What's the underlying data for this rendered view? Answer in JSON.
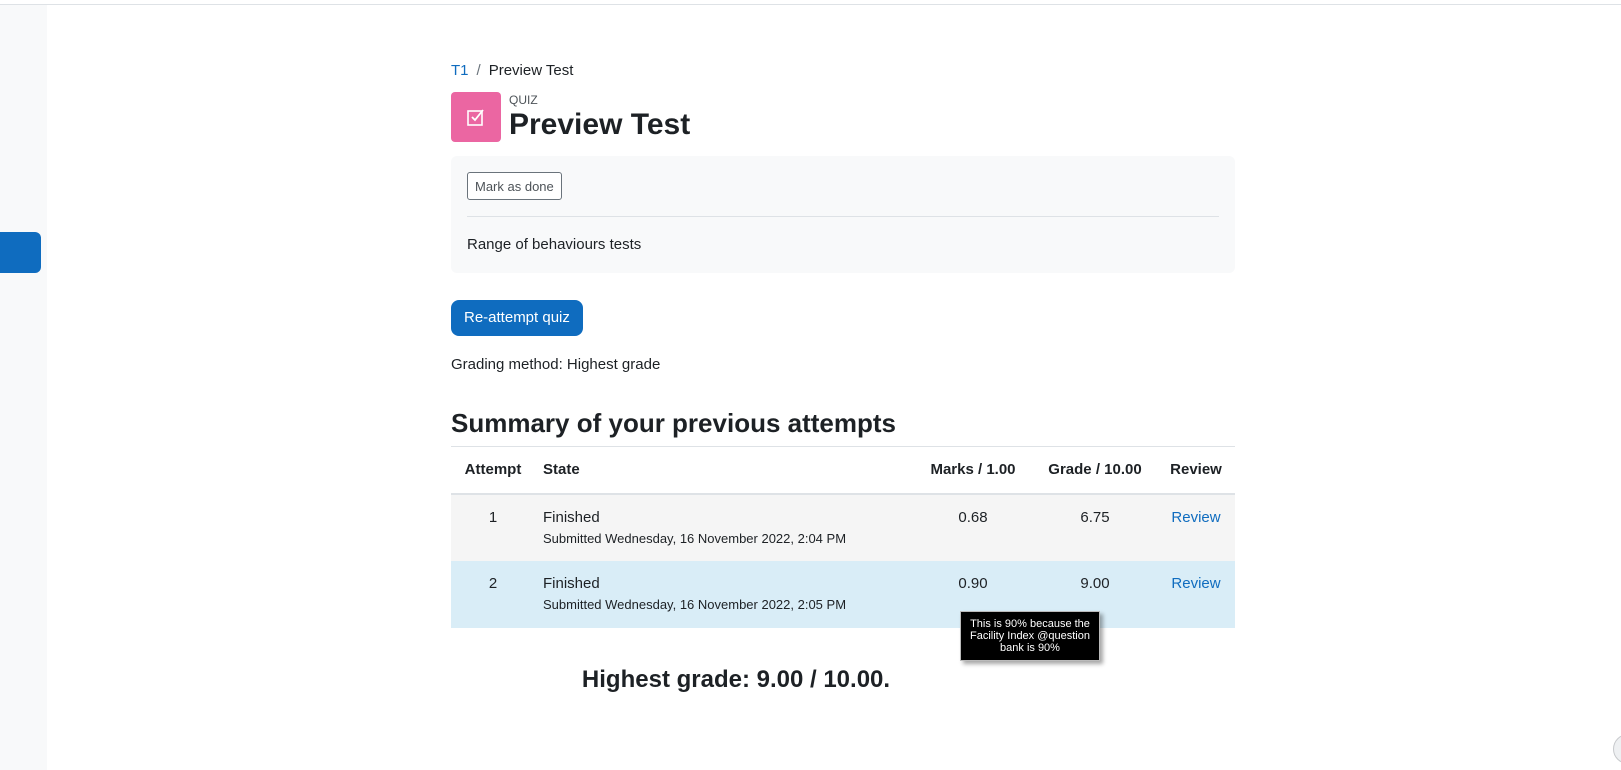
{
  "breadcrumb": {
    "course": "T1",
    "separator": "/",
    "current": "Preview Test"
  },
  "header": {
    "kicker": "QUIZ",
    "title": "Preview Test",
    "icon": "quiz-checkbox-icon",
    "icon_color": "#eb66a2"
  },
  "activity": {
    "mark_done_label": "Mark as done",
    "description": "Range of behaviours tests"
  },
  "reattempt_label": "Re-attempt quiz",
  "grading_method": "Grading method: Highest grade",
  "summary": {
    "title": "Summary of your previous attempts",
    "columns": [
      "Attempt",
      "State",
      "Marks / 1.00",
      "Grade / 10.00",
      "Review"
    ],
    "rows": [
      {
        "attempt": "1",
        "state": "Finished",
        "submitted": "Submitted Wednesday, 16 November 2022, 2:04 PM",
        "marks": "0.68",
        "grade": "6.75",
        "review": "Review"
      },
      {
        "attempt": "2",
        "state": "Finished",
        "submitted": "Submitted Wednesday, 16 November 2022, 2:05 PM",
        "marks": "0.90",
        "grade": "9.00",
        "review": "Review"
      }
    ]
  },
  "tooltip": "This is 90% because the Facility Index @question bank is 90%",
  "highest_grade": "Highest grade: 9.00 / 10.00.",
  "colors": {
    "primary": "#0f6cbf",
    "highlight_row": "#d9edf7"
  }
}
